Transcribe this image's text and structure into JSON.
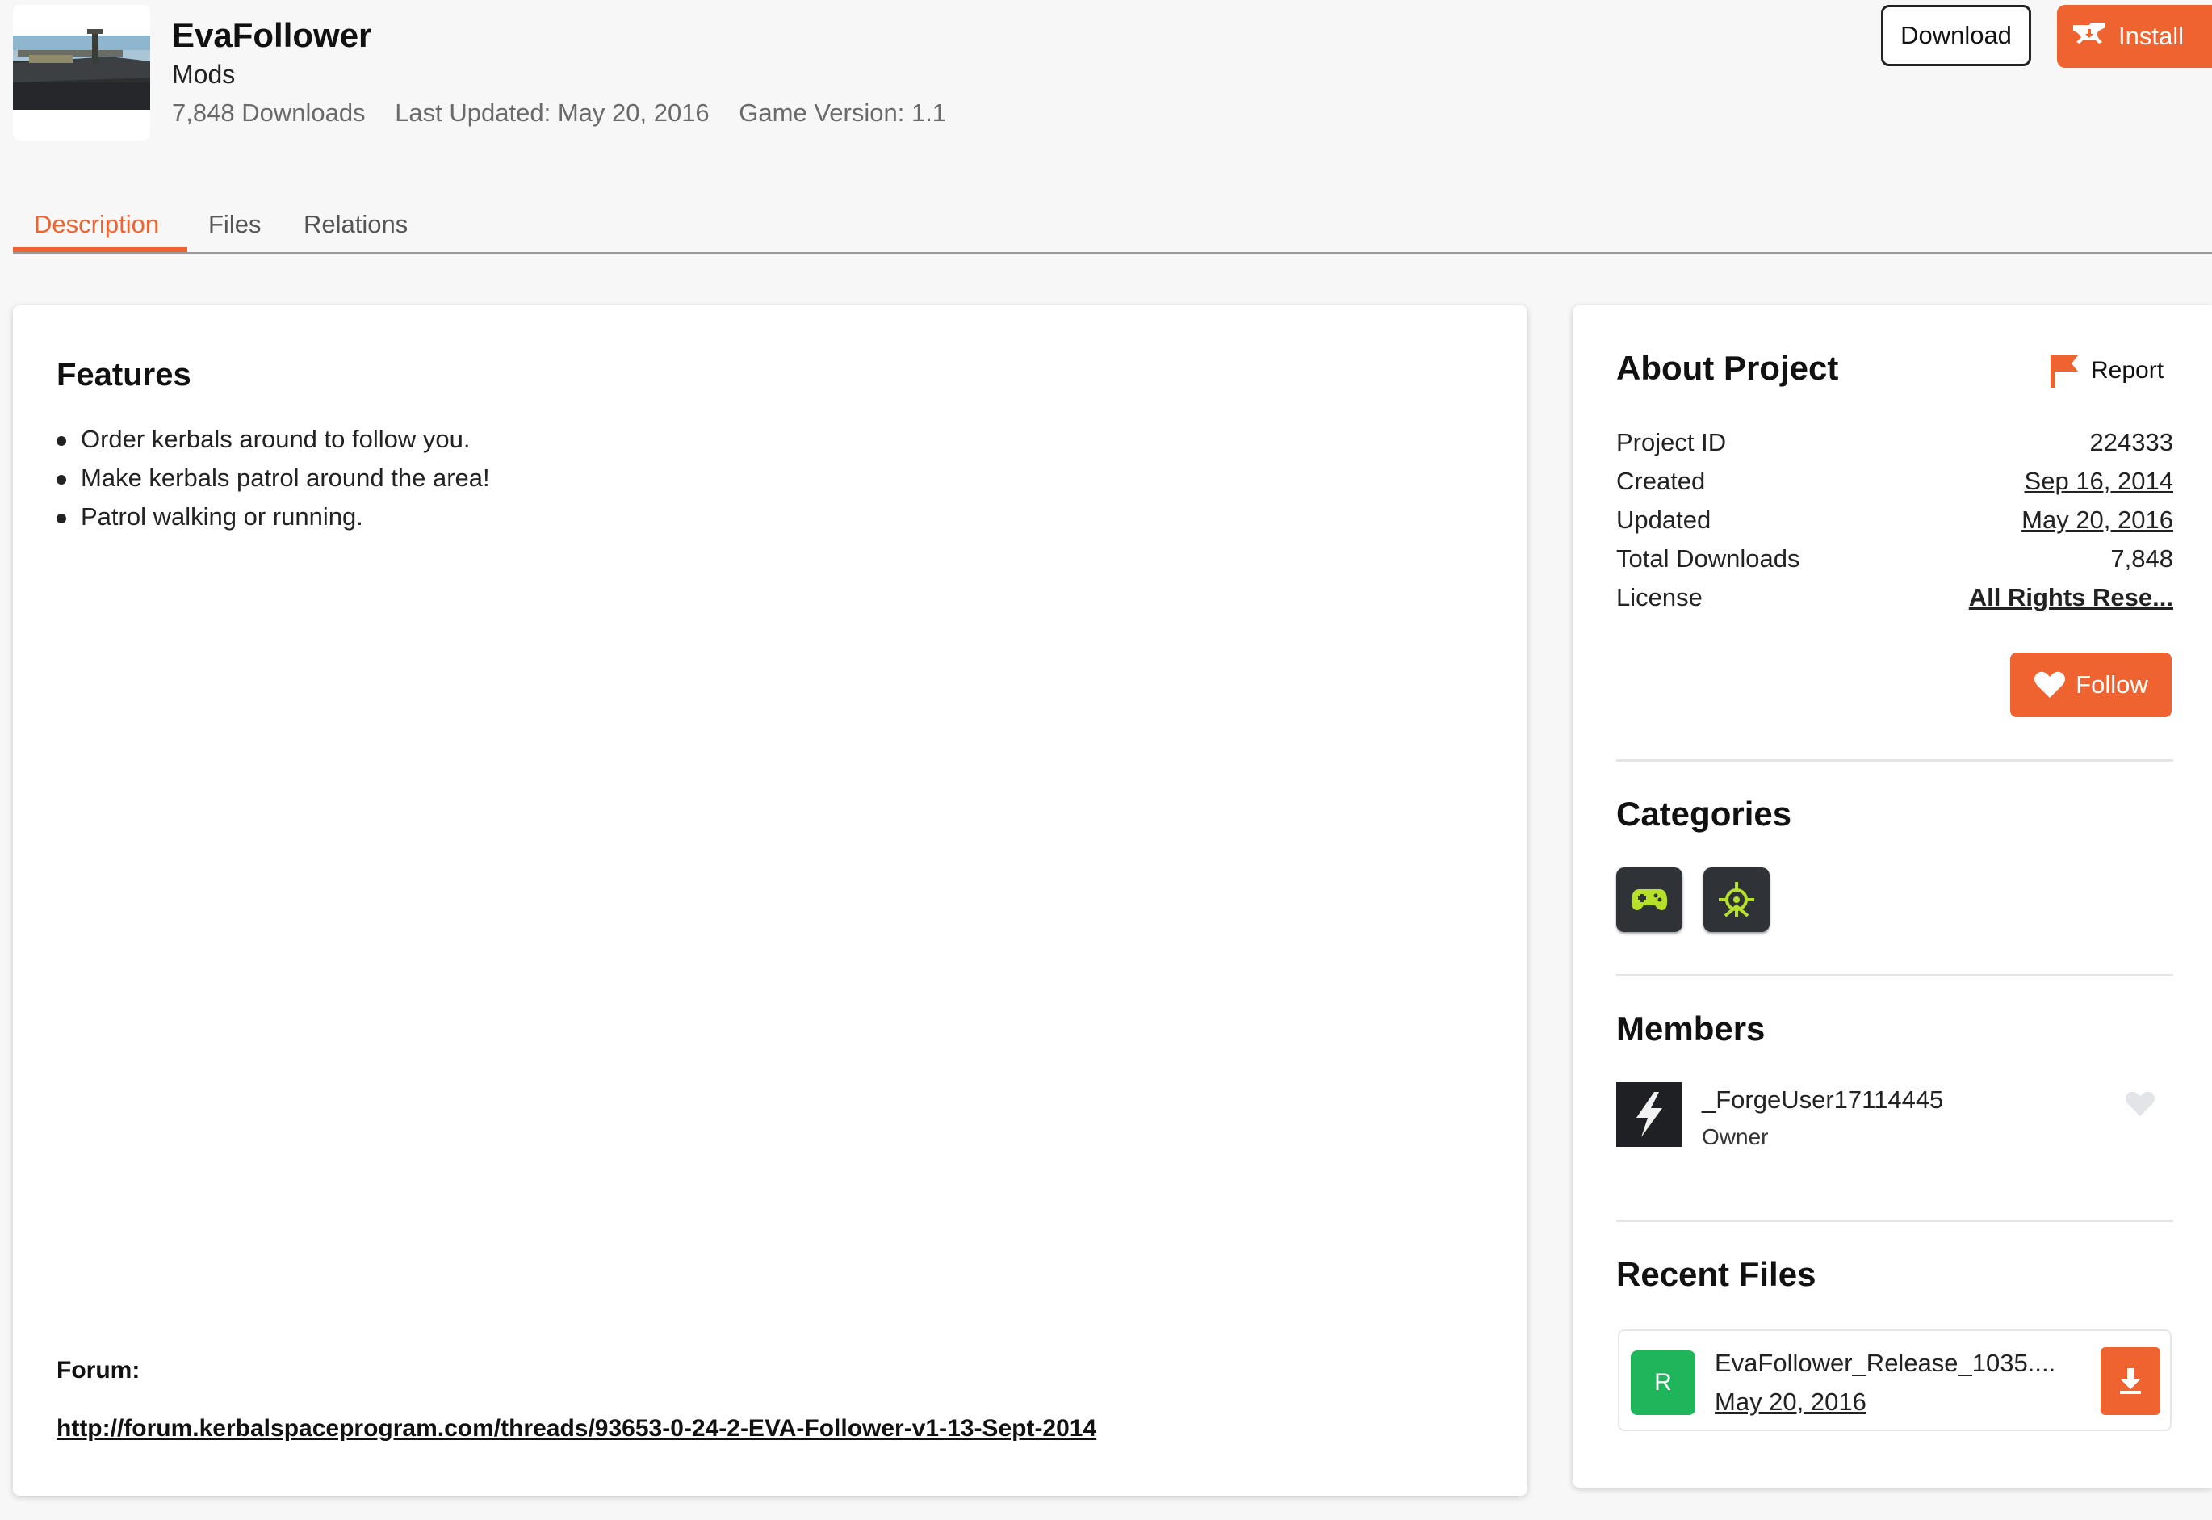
{
  "project": {
    "title": "EvaFollower",
    "class": "Mods",
    "downloads": "7,848 Downloads",
    "last_updated": "Last Updated: May 20, 2016",
    "game_version": "Game Version: 1.1"
  },
  "actions": {
    "download_label": "Download",
    "install_label": "Install"
  },
  "tabs": [
    {
      "label": "Description",
      "active": true
    },
    {
      "label": "Files",
      "active": false
    },
    {
      "label": "Relations",
      "active": false
    }
  ],
  "description": {
    "heading": "Features",
    "features": [
      "Order kerbals around to follow you.",
      "Make kerbals patrol around the area!",
      "Patrol walking or running."
    ],
    "forum_label": "Forum:",
    "forum_link": "http://forum.kerbalspaceprogram.com/threads/93653-0-24-2-EVA-Follower-v1-13-Sept-2014"
  },
  "about": {
    "heading": "About Project",
    "report_label": "Report",
    "rows": [
      {
        "label": "Project ID",
        "value": "224333"
      },
      {
        "label": "Created",
        "value": "Sep 16, 2014"
      },
      {
        "label": "Updated",
        "value": "May 20, 2016"
      },
      {
        "label": "Total Downloads",
        "value": "7,848"
      },
      {
        "label": "License",
        "value": "All Rights Rese..."
      }
    ],
    "follow_label": "Follow"
  },
  "categories": {
    "heading": "Categories",
    "icons": [
      "gamepad-icon",
      "gameplay-target-icon"
    ],
    "icon_color": "#b7e02b"
  },
  "members": {
    "heading": "Members",
    "list": [
      {
        "name": "_ForgeUser17114445",
        "role": "Owner",
        "avatar_icon": "lightning-icon"
      }
    ]
  },
  "recent_files": {
    "heading": "Recent Files",
    "files": [
      {
        "badge": "R",
        "name": "EvaFollower_Release_1035....",
        "date": "May 20, 2016"
      }
    ]
  },
  "colors": {
    "accent": "#ef6331",
    "release_badge": "#1fb55a"
  }
}
